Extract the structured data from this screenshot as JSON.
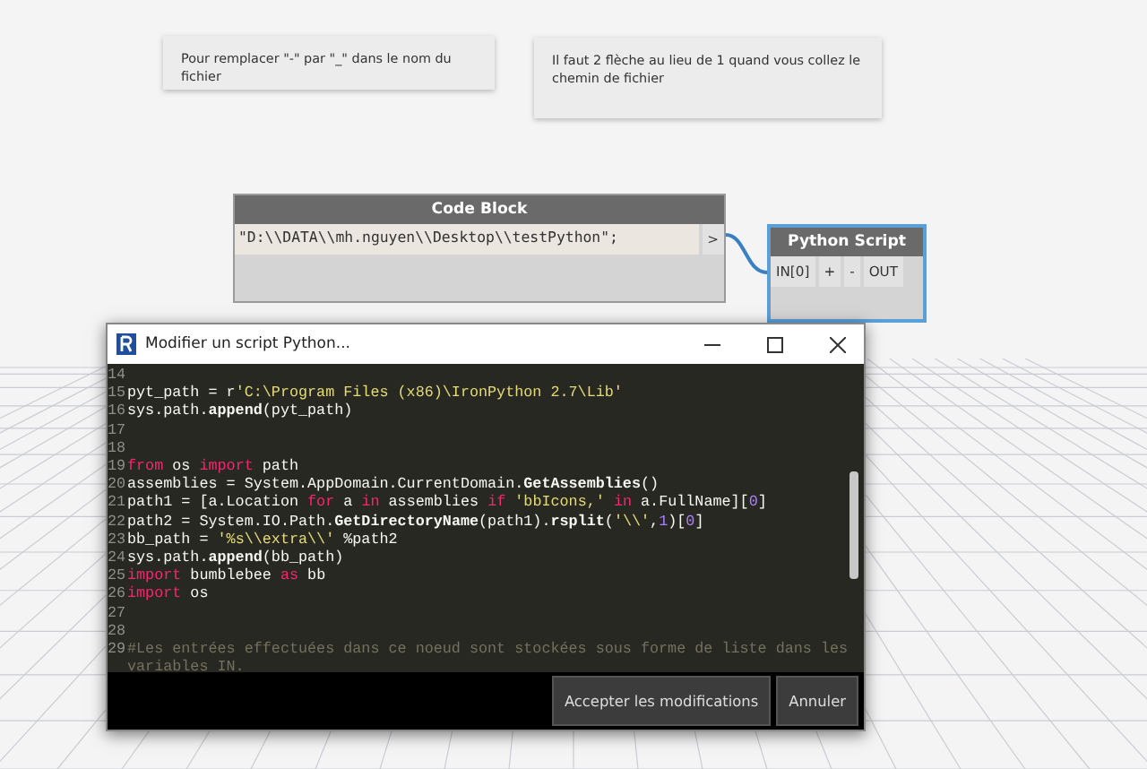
{
  "notes": [
    {
      "text": "Pour remplacer \"-\" par \"_\" dans le nom du fichier"
    },
    {
      "text": "Il faut 2 flèche au lieu de 1 quand vous collez le chemin de fichier"
    }
  ],
  "code_block": {
    "title": "Code Block",
    "code": "\"D:\\\\DATA\\\\mh.nguyen\\\\Desktop\\\\testPython\";",
    "output_port": ">"
  },
  "python_node": {
    "title": "Python Script",
    "input_port": "IN[0]",
    "add": "+",
    "remove": "-",
    "output_port": "OUT",
    "selected": true
  },
  "dialog": {
    "title": "Modifier un script Python...",
    "lines": [
      {
        "number": "14"
      },
      {
        "number": "15",
        "tokens": [
          {
            "kind": "plain",
            "text": "pyt_path = r"
          },
          {
            "kind": "str",
            "text": "'C:\\Program Files (x86)\\IronPython 2.7\\Lib'"
          }
        ]
      },
      {
        "number": "16",
        "tokens": [
          {
            "kind": "plain",
            "text": "sys.path."
          },
          {
            "kind": "fn",
            "text": "append"
          },
          {
            "kind": "plain",
            "text": "(pyt_path)"
          }
        ]
      },
      {
        "number": "17"
      },
      {
        "number": "18"
      },
      {
        "number": "19",
        "tokens": [
          {
            "kind": "kw",
            "text": "from"
          },
          {
            "kind": "plain",
            "text": " os "
          },
          {
            "kind": "kw",
            "text": "import"
          },
          {
            "kind": "plain",
            "text": " path"
          }
        ]
      },
      {
        "number": "20",
        "tokens": [
          {
            "kind": "plain",
            "text": "assemblies = System.AppDomain.CurrentDomain."
          },
          {
            "kind": "fn",
            "text": "GetAssemblies"
          },
          {
            "kind": "plain",
            "text": "()"
          }
        ]
      },
      {
        "number": "21",
        "tokens": [
          {
            "kind": "plain",
            "text": "path1 = [a.Location "
          },
          {
            "kind": "kw",
            "text": "for"
          },
          {
            "kind": "plain",
            "text": " a "
          },
          {
            "kind": "kw",
            "text": "in"
          },
          {
            "kind": "plain",
            "text": " assemblies "
          },
          {
            "kind": "kw",
            "text": "if"
          },
          {
            "kind": "str",
            "text": " 'bbIcons,' "
          },
          {
            "kind": "kw",
            "text": "in"
          },
          {
            "kind": "plain",
            "text": " a.FullName]["
          },
          {
            "kind": "num",
            "text": "0"
          },
          {
            "kind": "plain",
            "text": "]"
          }
        ]
      },
      {
        "number": "22",
        "tokens": [
          {
            "kind": "plain",
            "text": "path2 = System.IO.Path."
          },
          {
            "kind": "fn",
            "text": "GetDirectoryName"
          },
          {
            "kind": "plain",
            "text": "(path1)."
          },
          {
            "kind": "fn",
            "text": "rsplit"
          },
          {
            "kind": "plain",
            "text": "("
          },
          {
            "kind": "str",
            "text": "'\\\\'"
          },
          {
            "kind": "plain",
            "text": ","
          },
          {
            "kind": "num",
            "text": "1"
          },
          {
            "kind": "plain",
            "text": ")["
          },
          {
            "kind": "num",
            "text": "0"
          },
          {
            "kind": "plain",
            "text": "]"
          }
        ]
      },
      {
        "number": "23",
        "tokens": [
          {
            "kind": "plain",
            "text": "bb_path = "
          },
          {
            "kind": "str",
            "text": "'%s\\\\extra\\\\'"
          },
          {
            "kind": "plain",
            "text": " %path2"
          }
        ]
      },
      {
        "number": "24",
        "tokens": [
          {
            "kind": "plain",
            "text": "sys.path."
          },
          {
            "kind": "fn",
            "text": "append"
          },
          {
            "kind": "plain",
            "text": "(bb_path)"
          }
        ]
      },
      {
        "number": "25",
        "tokens": [
          {
            "kind": "kw",
            "text": "import"
          },
          {
            "kind": "plain",
            "text": " bumblebee "
          },
          {
            "kind": "kw",
            "text": "as"
          },
          {
            "kind": "plain",
            "text": " bb"
          }
        ]
      },
      {
        "number": "26",
        "tokens": [
          {
            "kind": "kw",
            "text": "import"
          },
          {
            "kind": "plain",
            "text": " os"
          }
        ]
      },
      {
        "number": "27"
      },
      {
        "number": "28"
      },
      {
        "number": "29",
        "tokens": [
          {
            "kind": "cm",
            "text": "#Les entrées effectuées dans ce noeud sont stockées sous forme de liste dans les variables IN."
          }
        ]
      }
    ],
    "buttons": [
      "Accepter les modifications",
      "Annuler"
    ]
  }
}
